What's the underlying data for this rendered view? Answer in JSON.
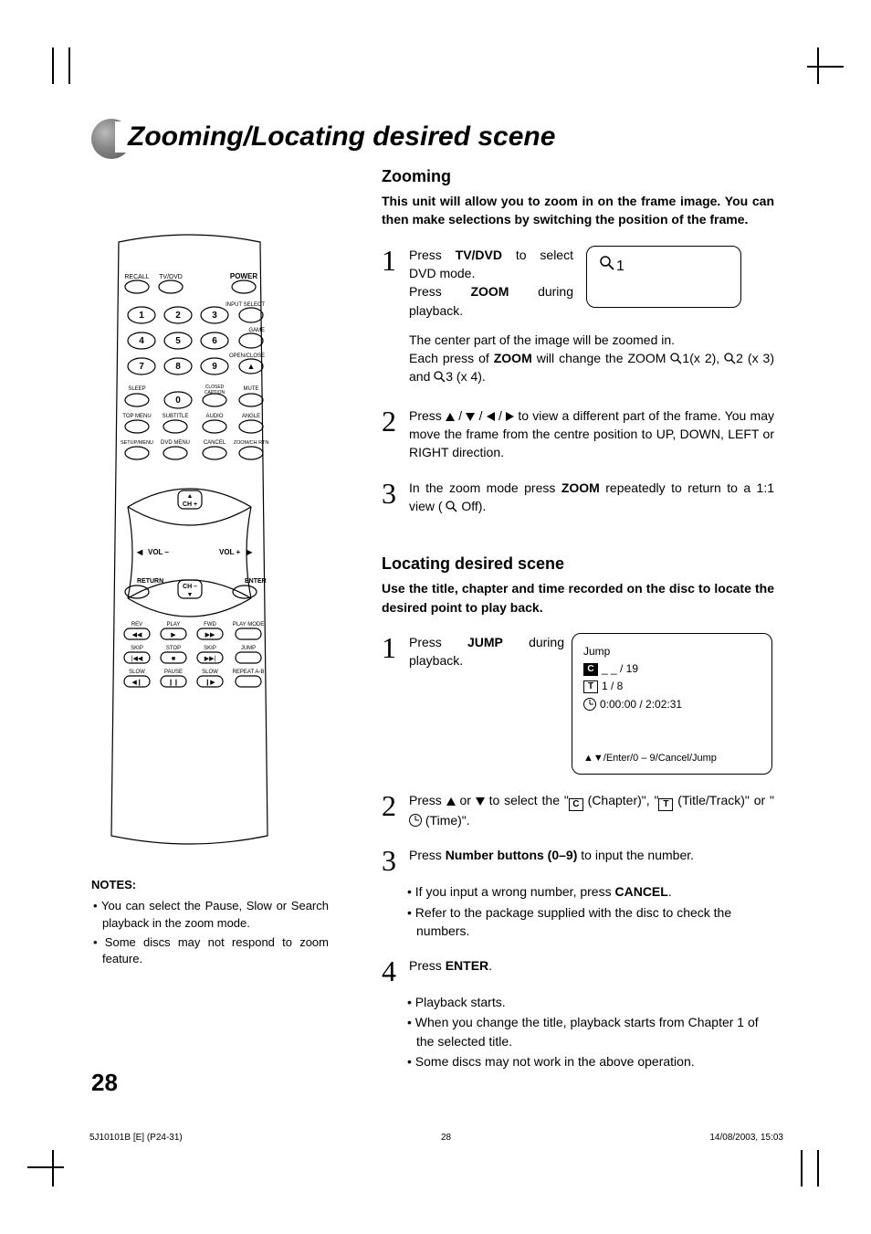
{
  "title": "Zooming/Locating desired scene",
  "zooming": {
    "heading": "Zooming",
    "lead": "This unit will allow you to zoom in on the frame image. You can then make selections by switching the position of the frame.",
    "step1a": "Press ",
    "step1b": "TV/DVD",
    "step1c": " to select DVD mode.",
    "step1d": "Press ",
    "step1e": "ZOOM",
    "step1f": " during playback.",
    "zoomBox": "1",
    "step1g": "The center part of the image will be zoomed in.",
    "step1h_a": "Each press of ",
    "step1h_b": "ZOOM",
    "step1h_c": " will change the ZOOM ",
    "step1h_d": "1(x 2), ",
    "step1h_e": "2 (x 3) and ",
    "step1h_f": "3 (x 4).",
    "step2a": "Press ",
    "step2b": " to view a different part of the frame. You may move the frame from the centre position to UP, DOWN, LEFT or RIGHT direction.",
    "step3a": "In the zoom mode press ",
    "step3b": "ZOOM",
    "step3c": " repeatedly to return to a 1:1 view (",
    "step3d": " Off)."
  },
  "locating": {
    "heading": "Locating desired scene",
    "lead": "Use the title, chapter and time recorded on the disc to locate the desired point to play back.",
    "step1a": "Press ",
    "step1b": "JUMP",
    "step1c": " during playback.",
    "osd": {
      "jump": "Jump",
      "c": "C",
      "cval": "_ _ / 19",
      "t": "T",
      "tval": "1 / 8",
      "time": "0:00:00 / 2:02:31",
      "hint": "▲▼/Enter/0 – 9/Cancel/Jump"
    },
    "step2a": "Press ",
    "step2b": " or ",
    "step2c": " to select the \"",
    "step2d": " (Chapter)\", \"",
    "step2e": " (Title/Track)\" or \"",
    "step2f": " (Time)\".",
    "step3a": "Press ",
    "step3b": "Number buttons (0–9)",
    "step3c": " to input the number.",
    "step3_li1a": "If you input a wrong number, press ",
    "step3_li1b": "CANCEL",
    "step3_li1c": ".",
    "step3_li2": "Refer to the package supplied with the disc to check the numbers.",
    "step4a": "Press ",
    "step4b": "ENTER",
    "step4c": ".",
    "step4_li1": "Playback starts.",
    "step4_li2": "When you change the title, playback starts from Chapter 1 of the selected title.",
    "step4_li3": "Some discs may not work in the above operation."
  },
  "notes": {
    "heading": "NOTES:",
    "li1": "You can select the Pause, Slow or Search playback in the zoom mode.",
    "li2": "Some discs may not respond to zoom feature."
  },
  "remote": {
    "recall": "RECALL",
    "tvdvd": "TV/DVD",
    "power": "POWER",
    "inputselect": "INPUT SELECT",
    "game": "GAME",
    "openclose": "OPEN/CLOSE",
    "sleep": "SLEEP",
    "cc": "CLOSED\nCAPTION",
    "mute": "MUTE",
    "topmenu": "TOP MENU",
    "subtitle": "SUBTITLE",
    "audio": "AUDIO",
    "angle": "ANGLE",
    "setup": "SETUP/MENU",
    "dvdmenu": "DVD MENU",
    "cancel": "CANCEL",
    "zoomch": "ZOOM/CH RTN",
    "chplus": "CH +",
    "chminus": "CH –",
    "volminus": "VOL –",
    "volplus": "VOL +",
    "return": "RETURN",
    "enter": "ENTER",
    "rev": "REV",
    "play": "PLAY",
    "fwd": "FWD",
    "playmode": "PLAY MODE",
    "skipL": "SKIP",
    "stop": "STOP",
    "skipR": "SKIP",
    "jump": "JUMP",
    "slowL": "SLOW",
    "pause": "PAUSE",
    "slowR": "SLOW",
    "repeat": "REPEAT A-B"
  },
  "page_number": "28",
  "footer": {
    "left": "5J10101B [E] (P24-31)",
    "mid": "28",
    "right": "14/08/2003, 15:03"
  }
}
